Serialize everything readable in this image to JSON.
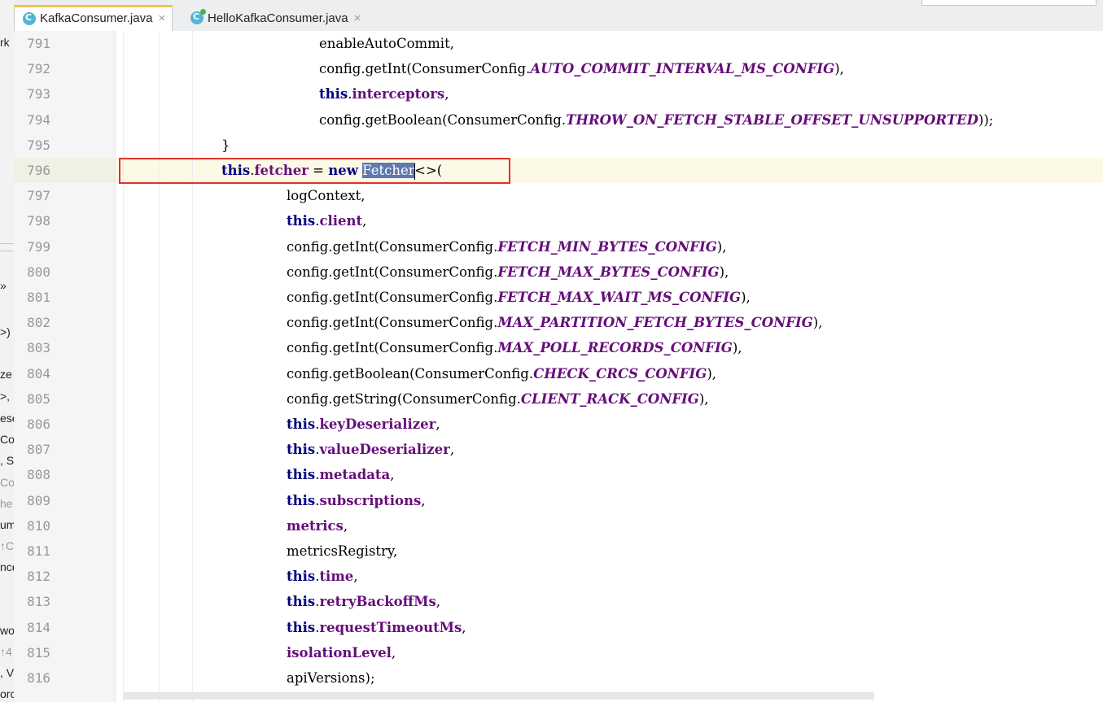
{
  "tabs": [
    {
      "label": "KafkaConsumer.java",
      "close": "×",
      "active": true,
      "icon": "java-class-icon"
    },
    {
      "label": "HelloKafkaConsumer.java",
      "close": "×",
      "active": false,
      "icon": "java-runnable-class-icon"
    }
  ],
  "left_panel": {
    "fragments": [
      "rk",
      "»",
      ">)",
      "ze",
      ">,",
      "ese",
      "Co",
      ", S",
      "Co",
      "he",
      "um",
      "↑C",
      "nce",
      "wo",
      "↑4",
      ", V",
      "orc"
    ]
  },
  "editor": {
    "highlighted_line": 796,
    "lines": [
      {
        "n": "791",
        "tokens": [
          {
            "t": "enableAutoCommit,"
          }
        ]
      },
      {
        "n": "792",
        "tokens": [
          {
            "t": "config.getInt(ConsumerConfig."
          },
          {
            "t": "AUTO_COMMIT_INTERVAL_MS_CONFIG",
            "c": "cst"
          },
          {
            "t": "),"
          }
        ]
      },
      {
        "n": "793",
        "tokens": [
          {
            "t": "this",
            "c": "kw"
          },
          {
            "t": "."
          },
          {
            "t": "interceptors",
            "c": "fld"
          },
          {
            "t": ","
          }
        ]
      },
      {
        "n": "794",
        "tokens": [
          {
            "t": "config.getBoolean(ConsumerConfig."
          },
          {
            "t": "THROW_ON_FETCH_STABLE_OFFSET_UNSUPPORTED",
            "c": "cst"
          },
          {
            "t": "));"
          }
        ]
      },
      {
        "n": "795",
        "tokens": [
          {
            "t": "}"
          }
        ]
      },
      {
        "n": "796",
        "tokens": [
          {
            "t": "this",
            "c": "kw"
          },
          {
            "t": "."
          },
          {
            "t": "fetcher",
            "c": "fld"
          },
          {
            "t": " = "
          },
          {
            "t": "new",
            "c": "kw"
          },
          {
            "t": " "
          },
          {
            "t": "Fetcher",
            "c": "sel"
          },
          {
            "t": "",
            "c": "caret"
          },
          {
            "t": "<>("
          }
        ]
      },
      {
        "n": "797",
        "tokens": [
          {
            "t": "logContext,"
          }
        ]
      },
      {
        "n": "798",
        "tokens": [
          {
            "t": "this",
            "c": "kw"
          },
          {
            "t": "."
          },
          {
            "t": "client",
            "c": "fld"
          },
          {
            "t": ","
          }
        ]
      },
      {
        "n": "799",
        "tokens": [
          {
            "t": "config.getInt(ConsumerConfig."
          },
          {
            "t": "FETCH_MIN_BYTES_CONFIG",
            "c": "cst"
          },
          {
            "t": "),"
          }
        ]
      },
      {
        "n": "800",
        "tokens": [
          {
            "t": "config.getInt(ConsumerConfig."
          },
          {
            "t": "FETCH_MAX_BYTES_CONFIG",
            "c": "cst"
          },
          {
            "t": "),"
          }
        ]
      },
      {
        "n": "801",
        "tokens": [
          {
            "t": "config.getInt(ConsumerConfig."
          },
          {
            "t": "FETCH_MAX_WAIT_MS_CONFIG",
            "c": "cst"
          },
          {
            "t": "),"
          }
        ]
      },
      {
        "n": "802",
        "tokens": [
          {
            "t": "config.getInt(ConsumerConfig."
          },
          {
            "t": "MAX_PARTITION_FETCH_BYTES_CONFIG",
            "c": "cst"
          },
          {
            "t": "),"
          }
        ]
      },
      {
        "n": "803",
        "tokens": [
          {
            "t": "config.getInt(ConsumerConfig."
          },
          {
            "t": "MAX_POLL_RECORDS_CONFIG",
            "c": "cst"
          },
          {
            "t": "),"
          }
        ]
      },
      {
        "n": "804",
        "tokens": [
          {
            "t": "config.getBoolean(ConsumerConfig."
          },
          {
            "t": "CHECK_CRCS_CONFIG",
            "c": "cst"
          },
          {
            "t": "),"
          }
        ]
      },
      {
        "n": "805",
        "tokens": [
          {
            "t": "config.getString(ConsumerConfig."
          },
          {
            "t": "CLIENT_RACK_CONFIG",
            "c": "cst"
          },
          {
            "t": "),"
          }
        ]
      },
      {
        "n": "806",
        "tokens": [
          {
            "t": "this",
            "c": "kw"
          },
          {
            "t": "."
          },
          {
            "t": "keyDeserializer",
            "c": "fld"
          },
          {
            "t": ","
          }
        ]
      },
      {
        "n": "807",
        "tokens": [
          {
            "t": "this",
            "c": "kw"
          },
          {
            "t": "."
          },
          {
            "t": "valueDeserializer",
            "c": "fld"
          },
          {
            "t": ","
          }
        ]
      },
      {
        "n": "808",
        "tokens": [
          {
            "t": "this",
            "c": "kw"
          },
          {
            "t": "."
          },
          {
            "t": "metadata",
            "c": "fld"
          },
          {
            "t": ","
          }
        ]
      },
      {
        "n": "809",
        "tokens": [
          {
            "t": "this",
            "c": "kw"
          },
          {
            "t": "."
          },
          {
            "t": "subscriptions",
            "c": "fld"
          },
          {
            "t": ","
          }
        ]
      },
      {
        "n": "810",
        "tokens": [
          {
            "t": "metrics",
            "c": "fld"
          },
          {
            "t": ","
          }
        ]
      },
      {
        "n": "811",
        "tokens": [
          {
            "t": "metricsRegistry,"
          }
        ]
      },
      {
        "n": "812",
        "tokens": [
          {
            "t": "this",
            "c": "kw"
          },
          {
            "t": "."
          },
          {
            "t": "time",
            "c": "fld"
          },
          {
            "t": ","
          }
        ]
      },
      {
        "n": "813",
        "tokens": [
          {
            "t": "this",
            "c": "kw"
          },
          {
            "t": "."
          },
          {
            "t": "retryBackoffMs",
            "c": "fld"
          },
          {
            "t": ","
          }
        ]
      },
      {
        "n": "814",
        "tokens": [
          {
            "t": "this",
            "c": "kw"
          },
          {
            "t": "."
          },
          {
            "t": "requestTimeoutMs",
            "c": "fld"
          },
          {
            "t": ","
          }
        ]
      },
      {
        "n": "815",
        "tokens": [
          {
            "t": "isolationLevel",
            "c": "fld"
          },
          {
            "t": ","
          }
        ]
      },
      {
        "n": "816",
        "tokens": [
          {
            "t": "apiVersions);"
          }
        ]
      }
    ]
  }
}
